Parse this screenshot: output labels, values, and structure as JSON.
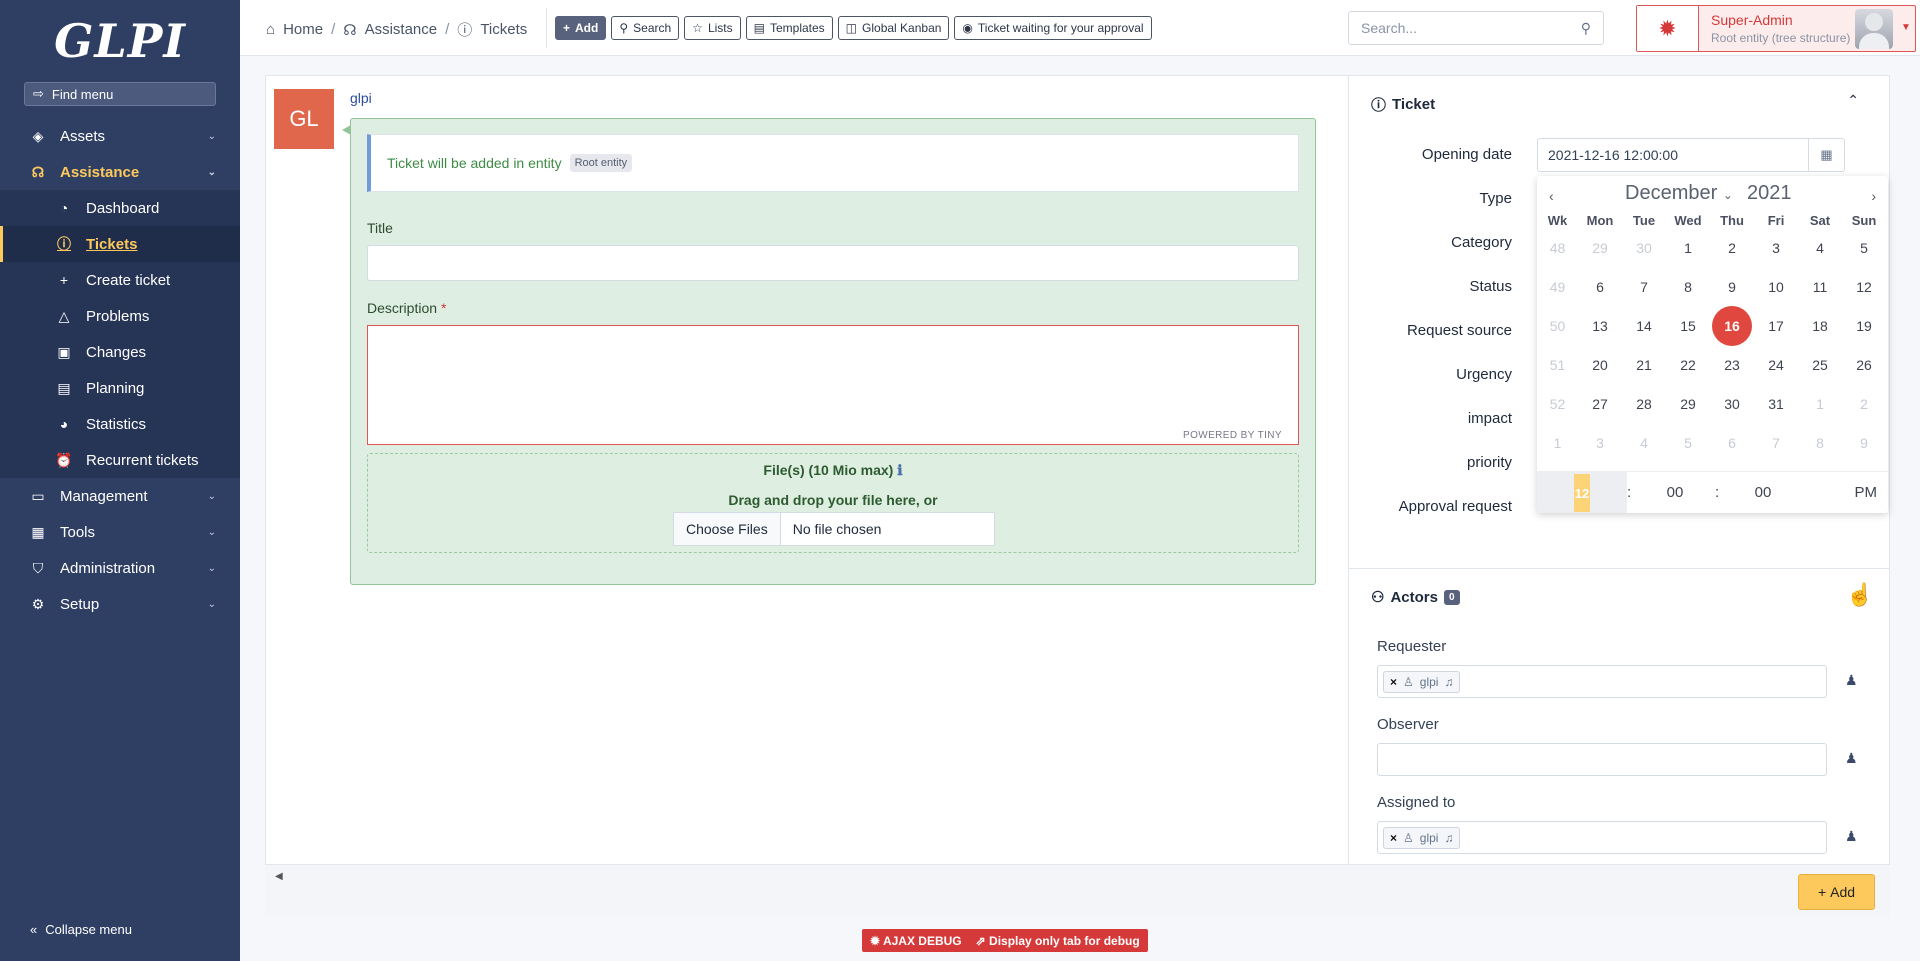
{
  "sidebar": {
    "logo": "GLPI",
    "find_menu": "Find menu",
    "collapse": "Collapse menu",
    "items": [
      {
        "label": "Assets"
      },
      {
        "label": "Assistance"
      },
      {
        "label": "Management"
      },
      {
        "label": "Tools"
      },
      {
        "label": "Administration"
      },
      {
        "label": "Setup"
      }
    ],
    "sub_items": [
      {
        "label": "Dashboard"
      },
      {
        "label": "Tickets"
      },
      {
        "label": "Create ticket"
      },
      {
        "label": "Problems"
      },
      {
        "label": "Changes"
      },
      {
        "label": "Planning"
      },
      {
        "label": "Statistics"
      },
      {
        "label": "Recurrent tickets"
      }
    ]
  },
  "header": {
    "breadcrumb": [
      "Home",
      "Assistance",
      "Tickets"
    ],
    "actions": [
      "Add",
      "Search",
      "Lists",
      "Templates",
      "Global Kanban",
      "Ticket waiting for your approval"
    ],
    "search_placeholder": "Search...",
    "user_name": "Super-Admin",
    "user_entity": "Root entity (tree structure)"
  },
  "form": {
    "author_initials": "GL",
    "author_name": "glpi",
    "entity_msg": "Ticket will be added in entity",
    "entity_badge": "Root entity",
    "title_label": "Title",
    "description_label": "Description",
    "required_mark": "*",
    "powered_by": "POWERED BY TINY",
    "files_label": "File(s) (10 Mio max)",
    "drop_text": "Drag and drop your file here, or",
    "choose_files": "Choose Files",
    "no_file": "No file chosen"
  },
  "ticket_panel": {
    "title": "Ticket",
    "fields": [
      "Opening date",
      "Type",
      "Category",
      "Status",
      "Request source",
      "Urgency",
      "impact",
      "priority",
      "Approval request"
    ],
    "opening_date": "2021-12-16 12:00:00",
    "actors_title": "Actors",
    "actors_count": "0",
    "requester_label": "Requester",
    "observer_label": "Observer",
    "assigned_label": "Assigned to",
    "requester_value": "glpi",
    "assigned_value": "glpi",
    "add_button": "Add"
  },
  "datepicker": {
    "month": "December",
    "year": "2021",
    "headers": [
      "Wk",
      "Mon",
      "Tue",
      "Wed",
      "Thu",
      "Fri",
      "Sat",
      "Sun"
    ],
    "weeks": [
      [
        "48",
        "29",
        "30",
        "1",
        "2",
        "3",
        "4",
        "5"
      ],
      [
        "49",
        "6",
        "7",
        "8",
        "9",
        "10",
        "11",
        "12"
      ],
      [
        "50",
        "13",
        "14",
        "15",
        "16",
        "17",
        "18",
        "19"
      ],
      [
        "51",
        "20",
        "21",
        "22",
        "23",
        "24",
        "25",
        "26"
      ],
      [
        "52",
        "27",
        "28",
        "29",
        "30",
        "31",
        "1",
        "2"
      ],
      [
        "1",
        "3",
        "4",
        "5",
        "6",
        "7",
        "8",
        "9"
      ]
    ],
    "today": "16",
    "hour": "12",
    "minute": "00",
    "second": "00",
    "ampm": "PM",
    "colon": ":"
  },
  "debug": {
    "ajax": "AJAX DEBUG",
    "only_tab": "Display only tab for debug"
  },
  "colors": {
    "sidebar_bg": "#2f3f64",
    "accent": "#fec95c",
    "danger": "#d63939",
    "success_bg": "#dfeee2"
  }
}
